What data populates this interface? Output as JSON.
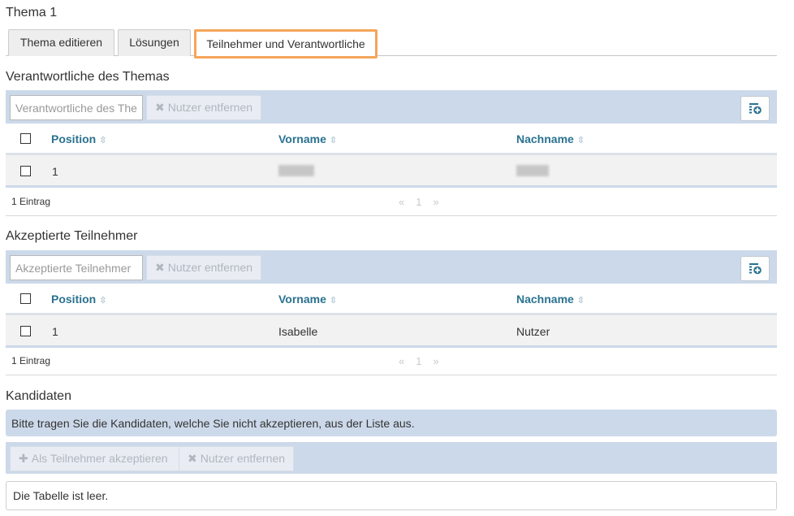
{
  "page_title": "Thema 1",
  "tabs": [
    {
      "label": "Thema editieren",
      "active": false
    },
    {
      "label": "Lösungen",
      "active": false
    },
    {
      "label": "Teilnehmer und Verantwortliche",
      "active": true
    }
  ],
  "responsible": {
    "title": "Verantwortliche des Themas",
    "filter_placeholder": "Verantwortliche des Themas",
    "remove_label": "Nutzer entfernen",
    "columns": [
      "Position",
      "Vorname",
      "Nachname"
    ],
    "rows": [
      {
        "position": "1",
        "first_name": "",
        "last_name": ""
      }
    ],
    "count_label": "1 Eintrag",
    "pager": {
      "prev": "«",
      "page": "1",
      "next": "»"
    }
  },
  "accepted": {
    "title": "Akzeptierte Teilnehmer",
    "filter_placeholder": "Akzeptierte Teilnehmer",
    "remove_label": "Nutzer entfernen",
    "columns": [
      "Position",
      "Vorname",
      "Nachname"
    ],
    "rows": [
      {
        "position": "1",
        "first_name": "Isabelle",
        "last_name": "Nutzer"
      }
    ],
    "count_label": "1 Eintrag",
    "pager": {
      "prev": "«",
      "page": "1",
      "next": "»"
    }
  },
  "candidates": {
    "title": "Kandidaten",
    "info": "Bitte tragen Sie die Kandidaten, welche Sie nicht akzeptieren, aus der Liste aus.",
    "accept_label": "Als Teilnehmer akzeptieren",
    "remove_label": "Nutzer entfernen",
    "empty_text": "Die Tabelle ist leer."
  },
  "colors": {
    "accent": "#f5a55a",
    "toolbar": "#ccd9ea",
    "header_text": "#2a7290"
  },
  "icons": {
    "remove": "times-icon",
    "add": "plus-icon",
    "columns": "column-settings-icon",
    "sort": "sort-icon"
  }
}
